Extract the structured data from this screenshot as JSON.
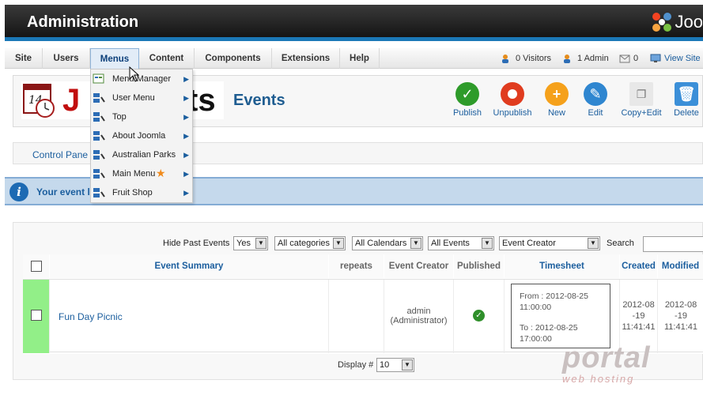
{
  "header": {
    "title": "Administration",
    "logo_text": "Joo"
  },
  "menubar": {
    "items": [
      "Site",
      "Users",
      "Menus",
      "Content",
      "Components",
      "Extensions",
      "Help"
    ],
    "visitors": "0 Visitors",
    "admin": "1 Admin",
    "messages": "0",
    "view_site": "View Site"
  },
  "dropdown": {
    "items": [
      "Menu Manager",
      "User Menu",
      "Top",
      "About Joomla",
      "Australian Parks",
      "Main Menu",
      "Fruit Shop"
    ]
  },
  "toolbar": {
    "logo_left": "J",
    "logo_right": "ts",
    "page_title": "Events",
    "buttons": [
      "Publish",
      "Unpublish",
      "New",
      "Edit",
      "Copy+Edit",
      "Delete"
    ]
  },
  "nav": {
    "control_panel": "Control Pane"
  },
  "info": {
    "message": "Your event l"
  },
  "filters": {
    "hide_past_label": "Hide Past Events",
    "hide_past_value": "Yes",
    "categories": "All categories",
    "calendars": "All Calendars",
    "events": "All Events",
    "creator": "Event Creator",
    "search_label": "Search"
  },
  "table": {
    "headers": [
      "Event Summary",
      "repeats",
      "Event Creator",
      "Published",
      "Timesheet",
      "Created",
      "Modified"
    ],
    "row": {
      "summary": "Fun Day Picnic",
      "creator_name": "admin",
      "creator_role": "(Administrator)",
      "from": "From : 2012-08-25",
      "from_time": "11:00:00",
      "to": "To : 2012-08-25",
      "to_time": "17:00:00",
      "created_1": "2012-08",
      "created_2": "-19",
      "created_3": "11:41:41",
      "modified_1": "2012-08",
      "modified_2": "-19",
      "modified_3": "11:41:41"
    },
    "display_label": "Display #",
    "display_value": "10"
  },
  "watermark": {
    "big": "portal",
    "small": "web hosting"
  }
}
